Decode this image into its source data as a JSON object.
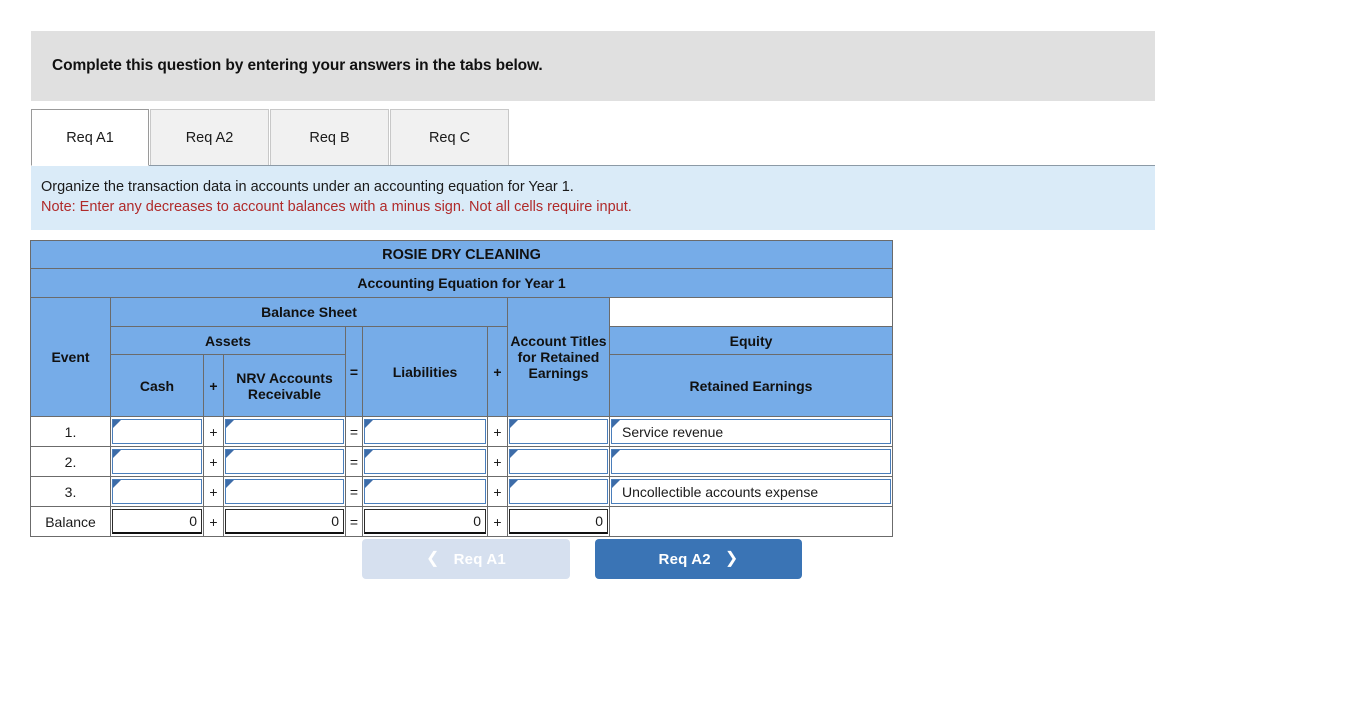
{
  "banner": {
    "text": "Complete this question by entering your answers in the tabs below."
  },
  "tabs": [
    {
      "label": "Req A1",
      "active": true
    },
    {
      "label": "Req A2",
      "active": false
    },
    {
      "label": "Req B",
      "active": false
    },
    {
      "label": "Req C",
      "active": false
    }
  ],
  "instructions": {
    "line1": "Organize the transaction data in accounts under an accounting equation for Year 1.",
    "line2": "Note: Enter any decreases to account balances with a minus sign. Not all cells require input."
  },
  "worksheet": {
    "company_title": "ROSIE DRY CLEANING",
    "subtitle": "Accounting Equation for Year 1",
    "group_balance_sheet": "Balance Sheet",
    "group_assets": "Assets",
    "group_equity": "Equity",
    "col_event": "Event",
    "col_cash": "Cash",
    "col_plus_1": "+",
    "col_ar": "NRV Accounts Receivable",
    "col_equals": "=",
    "col_liabilities": "Liabilities",
    "col_plus_2": "+",
    "col_retained_earnings": "Retained Earnings",
    "col_account_titles": "Account Titles for Retained Earnings",
    "rows": [
      {
        "event": "1.",
        "cash": "",
        "op1": "+",
        "accounts_receivable": "",
        "op_eq": "=",
        "liabilities": "",
        "op2": "+",
        "retained_earnings": "",
        "account_title": "Service revenue"
      },
      {
        "event": "2.",
        "cash": "",
        "op1": "+",
        "accounts_receivable": "",
        "op_eq": "=",
        "liabilities": "",
        "op2": "+",
        "retained_earnings": "",
        "account_title": ""
      },
      {
        "event": "3.",
        "cash": "",
        "op1": "+",
        "accounts_receivable": "",
        "op_eq": "=",
        "liabilities": "",
        "op2": "+",
        "retained_earnings": "",
        "account_title": "Uncollectible accounts expense"
      }
    ],
    "balance": {
      "label": "Balance",
      "cash": "0",
      "op1": "+",
      "accounts_receivable": "0",
      "op_eq": "=",
      "liabilities": "0",
      "op2": "+",
      "retained_earnings": "0",
      "account_title": ""
    }
  },
  "nav": {
    "prev_label": "Req A1",
    "prev_icon": "chevron-left-icon",
    "next_label": "Req A2",
    "next_icon": "chevron-right-icon"
  },
  "colors": {
    "header_blue": "#76ace8",
    "instruction_blue": "#daebf8",
    "banner_gray": "#e0e0e0",
    "note_red": "#b02a2a",
    "primary_button": "#3a74b5",
    "disabled_button": "#d6e0ef",
    "input_border": "#4a7ebb"
  }
}
